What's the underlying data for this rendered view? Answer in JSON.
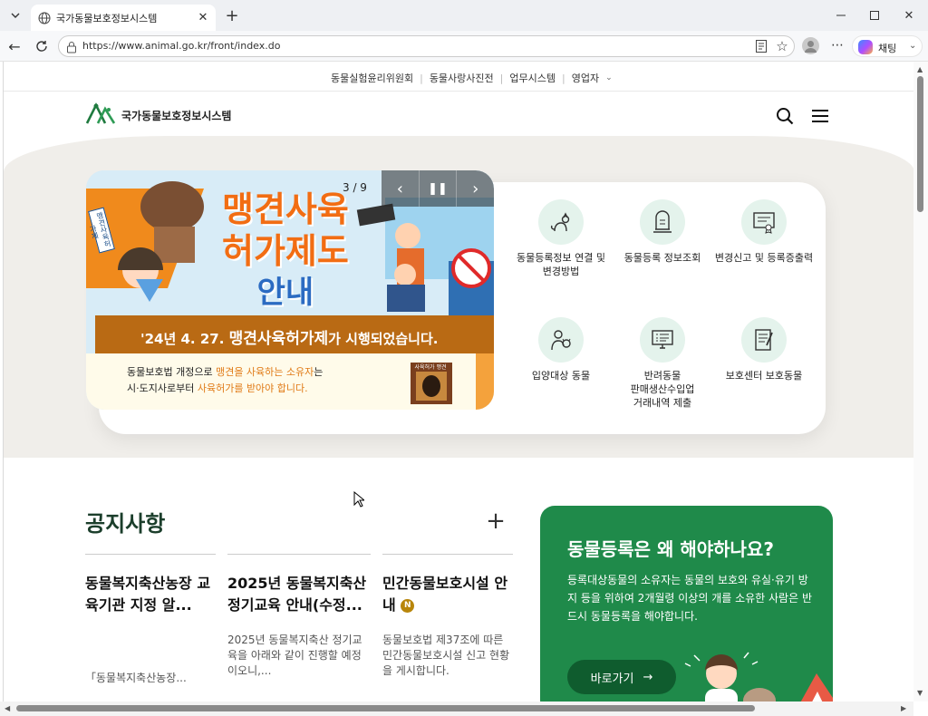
{
  "browser": {
    "tab_title": "국가동물보호정보시스템",
    "url": "https://www.animal.go.kr/front/index.do",
    "chat_label": "채팅"
  },
  "util_nav": [
    "동물실험윤리위원회",
    "동물사랑사진전",
    "업무시스템",
    "영업자"
  ],
  "site": {
    "logo_text": "국가동물보호정보시스템"
  },
  "banner": {
    "counter": "3 / 9",
    "title_line1": "맹견사육",
    "title_line2": "허가제도",
    "title_line3": "안내",
    "stamp": "맹견사육허가제",
    "sign": "사육허가 맹견",
    "notice_prefix": "'24년 4. 27. ",
    "notice_bold": "맹견사육허가제",
    "notice_suffix": "가 시행되었습니다.",
    "desc_line1_a": "동물보호법 개정으로 ",
    "desc_line1_b": "맹견을 사육하는 소유자",
    "desc_line1_c": "는",
    "desc_line2_a": "시·도지사로부터 ",
    "desc_line2_b": "사육허가를 받아야 합니다."
  },
  "quick_links": [
    {
      "label": "동물등록정보 연결 및\n변경방법",
      "icon": "cat-icon"
    },
    {
      "label": "동물등록 정보조회",
      "icon": "tombstone-icon"
    },
    {
      "label": "변경신고 및 등록증출력",
      "icon": "certificate-icon"
    },
    {
      "label": "입양대상 동물",
      "icon": "person-dog-icon"
    },
    {
      "label": "반려동물\n판매생산수입업\n거래내역 제출",
      "icon": "monitor-list-icon"
    },
    {
      "label": "보호센터 보호동물",
      "icon": "notepad-icon"
    }
  ],
  "notices": {
    "heading": "공지사항",
    "items": [
      {
        "title": "동물복지축산농장 교육기관 지정 알...",
        "body": "「동물복지축산농장..."
      },
      {
        "title": "2025년 동물복지축산 정기교육 안내(수정...",
        "body": "2025년 동물복지축산 정기교육을 아래와 같이 진행할 예정이오니,..."
      },
      {
        "title": "민간동물보호시설 안내",
        "badge": "N",
        "body": "동물보호법 제37조에 따른 민간동물보호시설 신고 현황을 게시합니다."
      }
    ]
  },
  "promo": {
    "title": "동물등록은 왜 해야하나요?",
    "body": "등록대상동물의 소유자는 동물의 보호와 유실·유기 방지 등을 위하여 2개월령 이상의 개를 소유한 사람은 반드시 동물등록을 해야합니다.",
    "button": "바로가기"
  }
}
